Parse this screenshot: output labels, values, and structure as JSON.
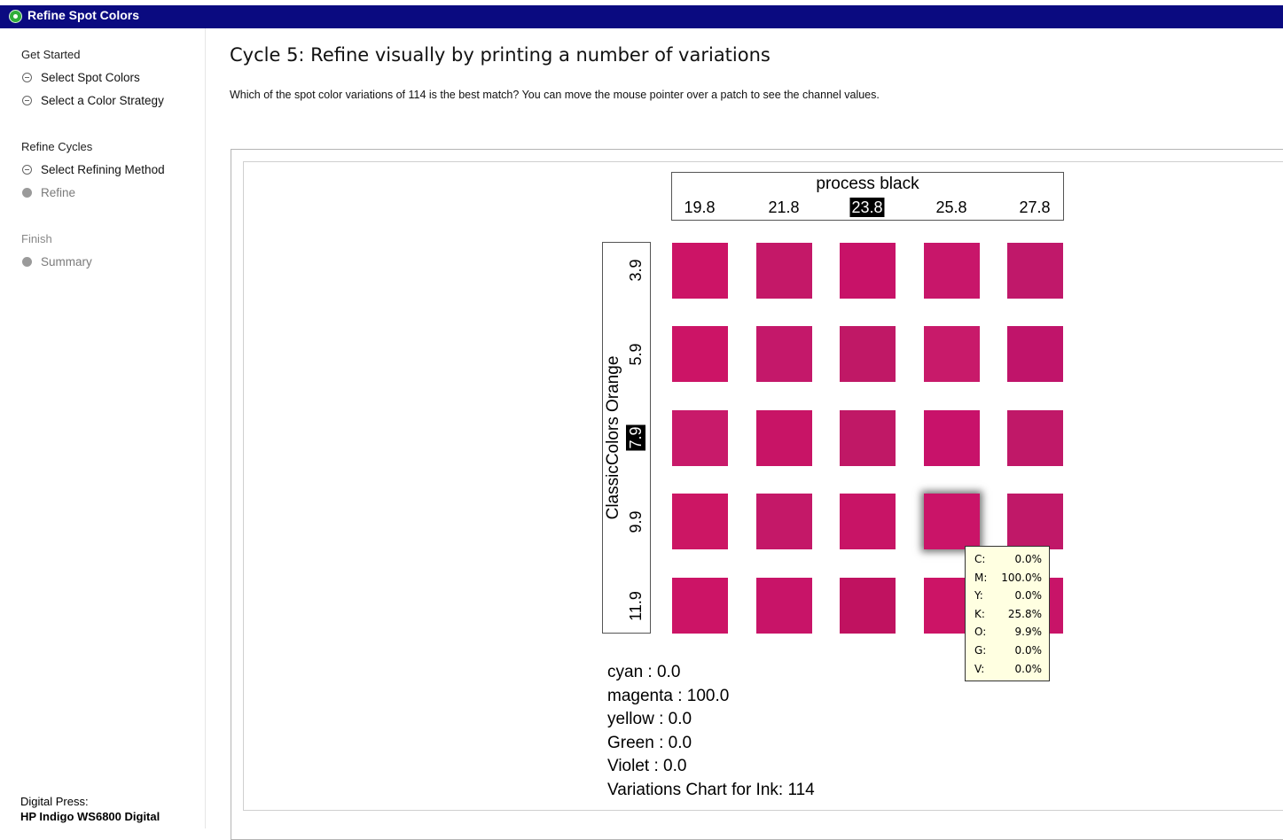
{
  "window": {
    "title": "Refine Spot Colors"
  },
  "sidebar": {
    "sections": [
      {
        "label": "Get Started",
        "state": "active"
      },
      {
        "label": "Refine Cycles",
        "state": "active"
      },
      {
        "label": "Finish",
        "state": "inactive"
      }
    ],
    "items": [
      {
        "label": "Select Spot Colors",
        "state": "done"
      },
      {
        "label": "Select a Color Strategy",
        "state": "done"
      },
      {
        "label": "Select Refining Method",
        "state": "done"
      },
      {
        "label": "Refine",
        "state": "current"
      },
      {
        "label": "Summary",
        "state": "pending"
      }
    ],
    "footer": {
      "label": "Digital Press:",
      "value": "HP Indigo WS6800 Digital"
    }
  },
  "main": {
    "heading": "Cycle 5: Refine visually by printing a number of variations",
    "instruction": "Which of the spot color variations of 114 is the best match? You can move the mouse pointer over a patch to see the channel values."
  },
  "grid": {
    "column_axis": {
      "name": "process black",
      "ticks": [
        "19.8",
        "21.8",
        "23.8",
        "25.8",
        "27.8"
      ],
      "selected_index": 2
    },
    "row_axis": {
      "name": "ClassicColors Orange",
      "ticks": [
        "3.9",
        "5.9",
        "7.9",
        "9.9",
        "11.9"
      ],
      "selected_index": 2
    },
    "hovered_patch": {
      "row": 3,
      "col": 3
    },
    "patch_colors": [
      [
        "#cc1466",
        "#c41868",
        "#c81268",
        "#c8166a",
        "#c0186a"
      ],
      [
        "#cc1466",
        "#c4186a",
        "#c01866",
        "#c81a6a",
        "#c0146a"
      ],
      [
        "#c81a6a",
        "#c81466",
        "#c01866",
        "#c8126a",
        "#c01868"
      ],
      [
        "#cc1664",
        "#c41868",
        "#c81466",
        "#ca1468",
        "#c01868"
      ],
      [
        "#cc1466",
        "#c81468",
        "#c01260",
        "#cc1466",
        "#c81468"
      ]
    ]
  },
  "tooltip": {
    "rows": [
      {
        "channel": "C:",
        "value": "0.0%"
      },
      {
        "channel": "M:",
        "value": "100.0%"
      },
      {
        "channel": "Y:",
        "value": "0.0%"
      },
      {
        "channel": "K:",
        "value": "25.8%"
      },
      {
        "channel": "O:",
        "value": "9.9%"
      },
      {
        "channel": "G:",
        "value": "0.0%"
      },
      {
        "channel": "V:",
        "value": "0.0%"
      }
    ]
  },
  "summary": {
    "lines": [
      "cyan : 0.0",
      "magenta : 100.0",
      "yellow : 0.0",
      "Green : 0.0",
      "Violet : 0.0",
      "Variations Chart for Ink: 114"
    ]
  }
}
